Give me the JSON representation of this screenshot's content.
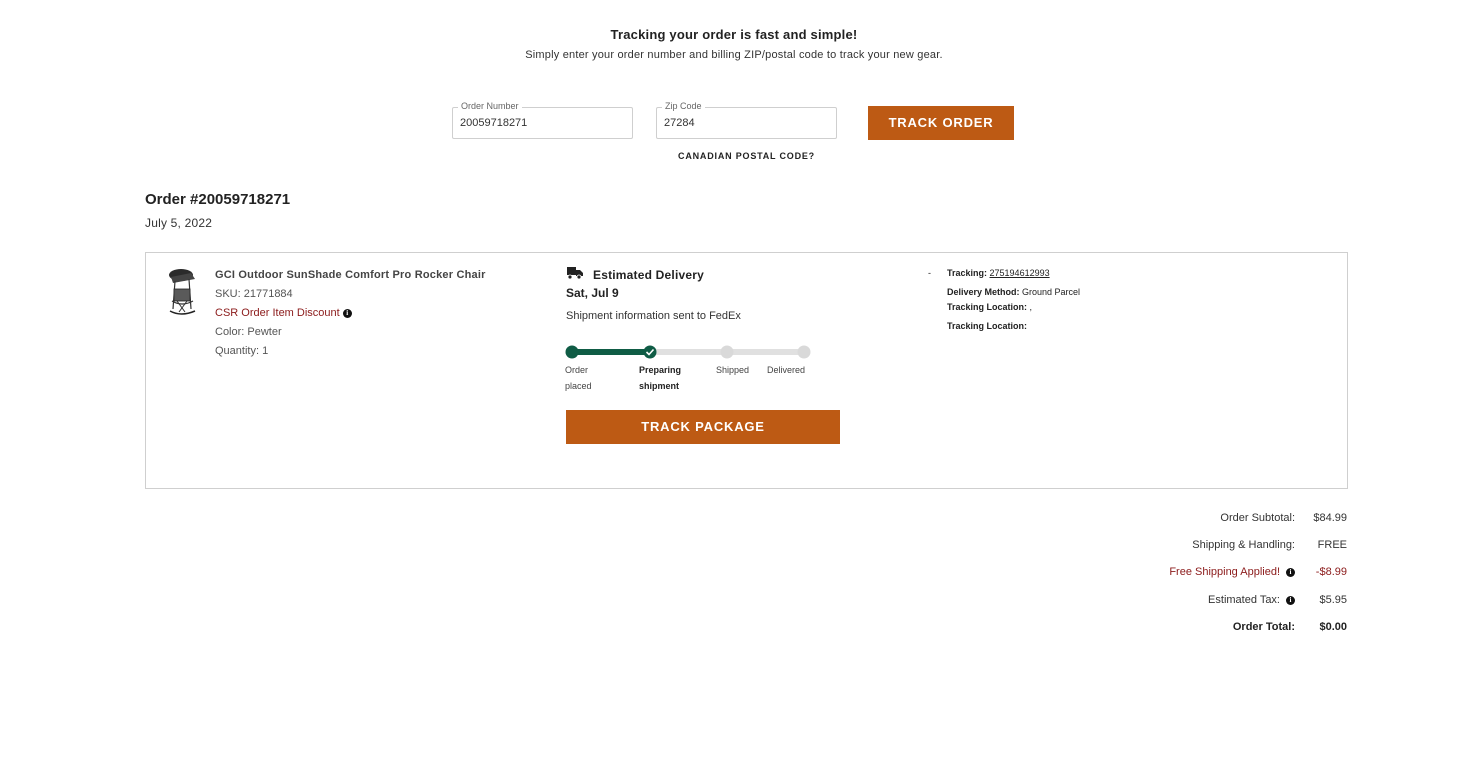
{
  "hero": {
    "title": "Tracking your order is fast and simple!",
    "subtitle": "Simply enter your order number and billing ZIP/postal code to track your new gear."
  },
  "form": {
    "order_number_label": "Order Number",
    "order_number_value": "20059718271",
    "zip_label": "Zip Code",
    "zip_value": "27284",
    "track_order_button": "TRACK ORDER",
    "canadian_link": "CANADIAN POSTAL CODE?"
  },
  "order": {
    "title": "Order #20059718271",
    "date": "July 5, 2022"
  },
  "item": {
    "name": "GCI Outdoor SunShade Comfort Pro Rocker Chair",
    "sku": "SKU: 21771884",
    "discount": "CSR Order Item Discount",
    "color": "Color: Pewter",
    "quantity": "Quantity: 1",
    "image_icon": "chair-image"
  },
  "delivery": {
    "heading": "Estimated Delivery",
    "date": "Sat, Jul 9",
    "status_text": "Shipment information sent to FedEx",
    "steps": [
      {
        "label_line1": "Order",
        "label_line2": "placed",
        "state": "done"
      },
      {
        "label_line1": "Preparing",
        "label_line2": "shipment",
        "state": "current"
      },
      {
        "label_line1": "Shipped",
        "label_line2": "",
        "state": "pending"
      },
      {
        "label_line1": "Delivered",
        "label_line2": "",
        "state": "pending"
      }
    ],
    "track_package_button": "TRACK PACKAGE",
    "progress_color": "#0f5c45"
  },
  "tracking": {
    "dash": "-",
    "tracking_label": "Tracking:",
    "tracking_number": "275194612993",
    "method_label": "Delivery Method:",
    "method_value": "Ground Parcel",
    "location1_label": "Tracking Location:",
    "location1_value": ",",
    "location2_label": "Tracking Location:",
    "location2_value": ""
  },
  "summary": {
    "subtotal_label": "Order Subtotal:",
    "subtotal_value": "$84.99",
    "shipping_label": "Shipping & Handling:",
    "shipping_value": "FREE",
    "free_ship_label": "Free Shipping Applied!",
    "free_ship_value": "-$8.99",
    "tax_label": "Estimated Tax:",
    "tax_value": "$5.95",
    "total_label": "Order Total:",
    "total_value": "$0.00"
  },
  "colors": {
    "accent": "#bd5a14",
    "progress": "#0f5c45",
    "discount": "#8b1a1a"
  }
}
